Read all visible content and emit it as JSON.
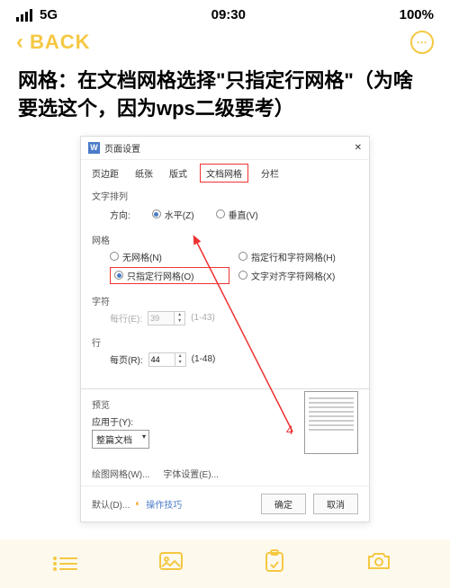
{
  "status": {
    "signal": "5G",
    "time": "09:30",
    "battery": "100%"
  },
  "nav": {
    "back": "BACK"
  },
  "title": "网格：在文档网格选择\"只指定行网格\"（为啥要选这个，因为wps二级要考）",
  "dialog": {
    "header": "页面设置",
    "tabs": [
      "页边距",
      "纸张",
      "版式",
      "文档网格",
      "分栏"
    ],
    "sec_layout": "文字排列",
    "direction_label": "方向:",
    "dir_h": "水平(Z)",
    "dir_v": "垂直(V)",
    "sec_grid": "网格",
    "grid_opts": [
      "无网格(N)",
      "指定行和字符网格(H)",
      "只指定行网格(O)",
      "文字对齐字符网格(X)"
    ],
    "sec_char": "字符",
    "char_perline": "每行(E):",
    "char_val": "39",
    "char_range": "(1-43)",
    "sec_line": "行",
    "line_perpage": "每页(R):",
    "line_val": "44",
    "line_range": "(1-48)",
    "sec_preview": "预览",
    "apply_label": "应用于(Y):",
    "apply_val": "整篇文档",
    "link_grid": "绘图网格(W)...",
    "link_font": "字体设置(E)...",
    "default": "默认(D)...",
    "tips": "操作技巧",
    "ok": "确定",
    "cancel": "取消"
  },
  "annotation": "4"
}
